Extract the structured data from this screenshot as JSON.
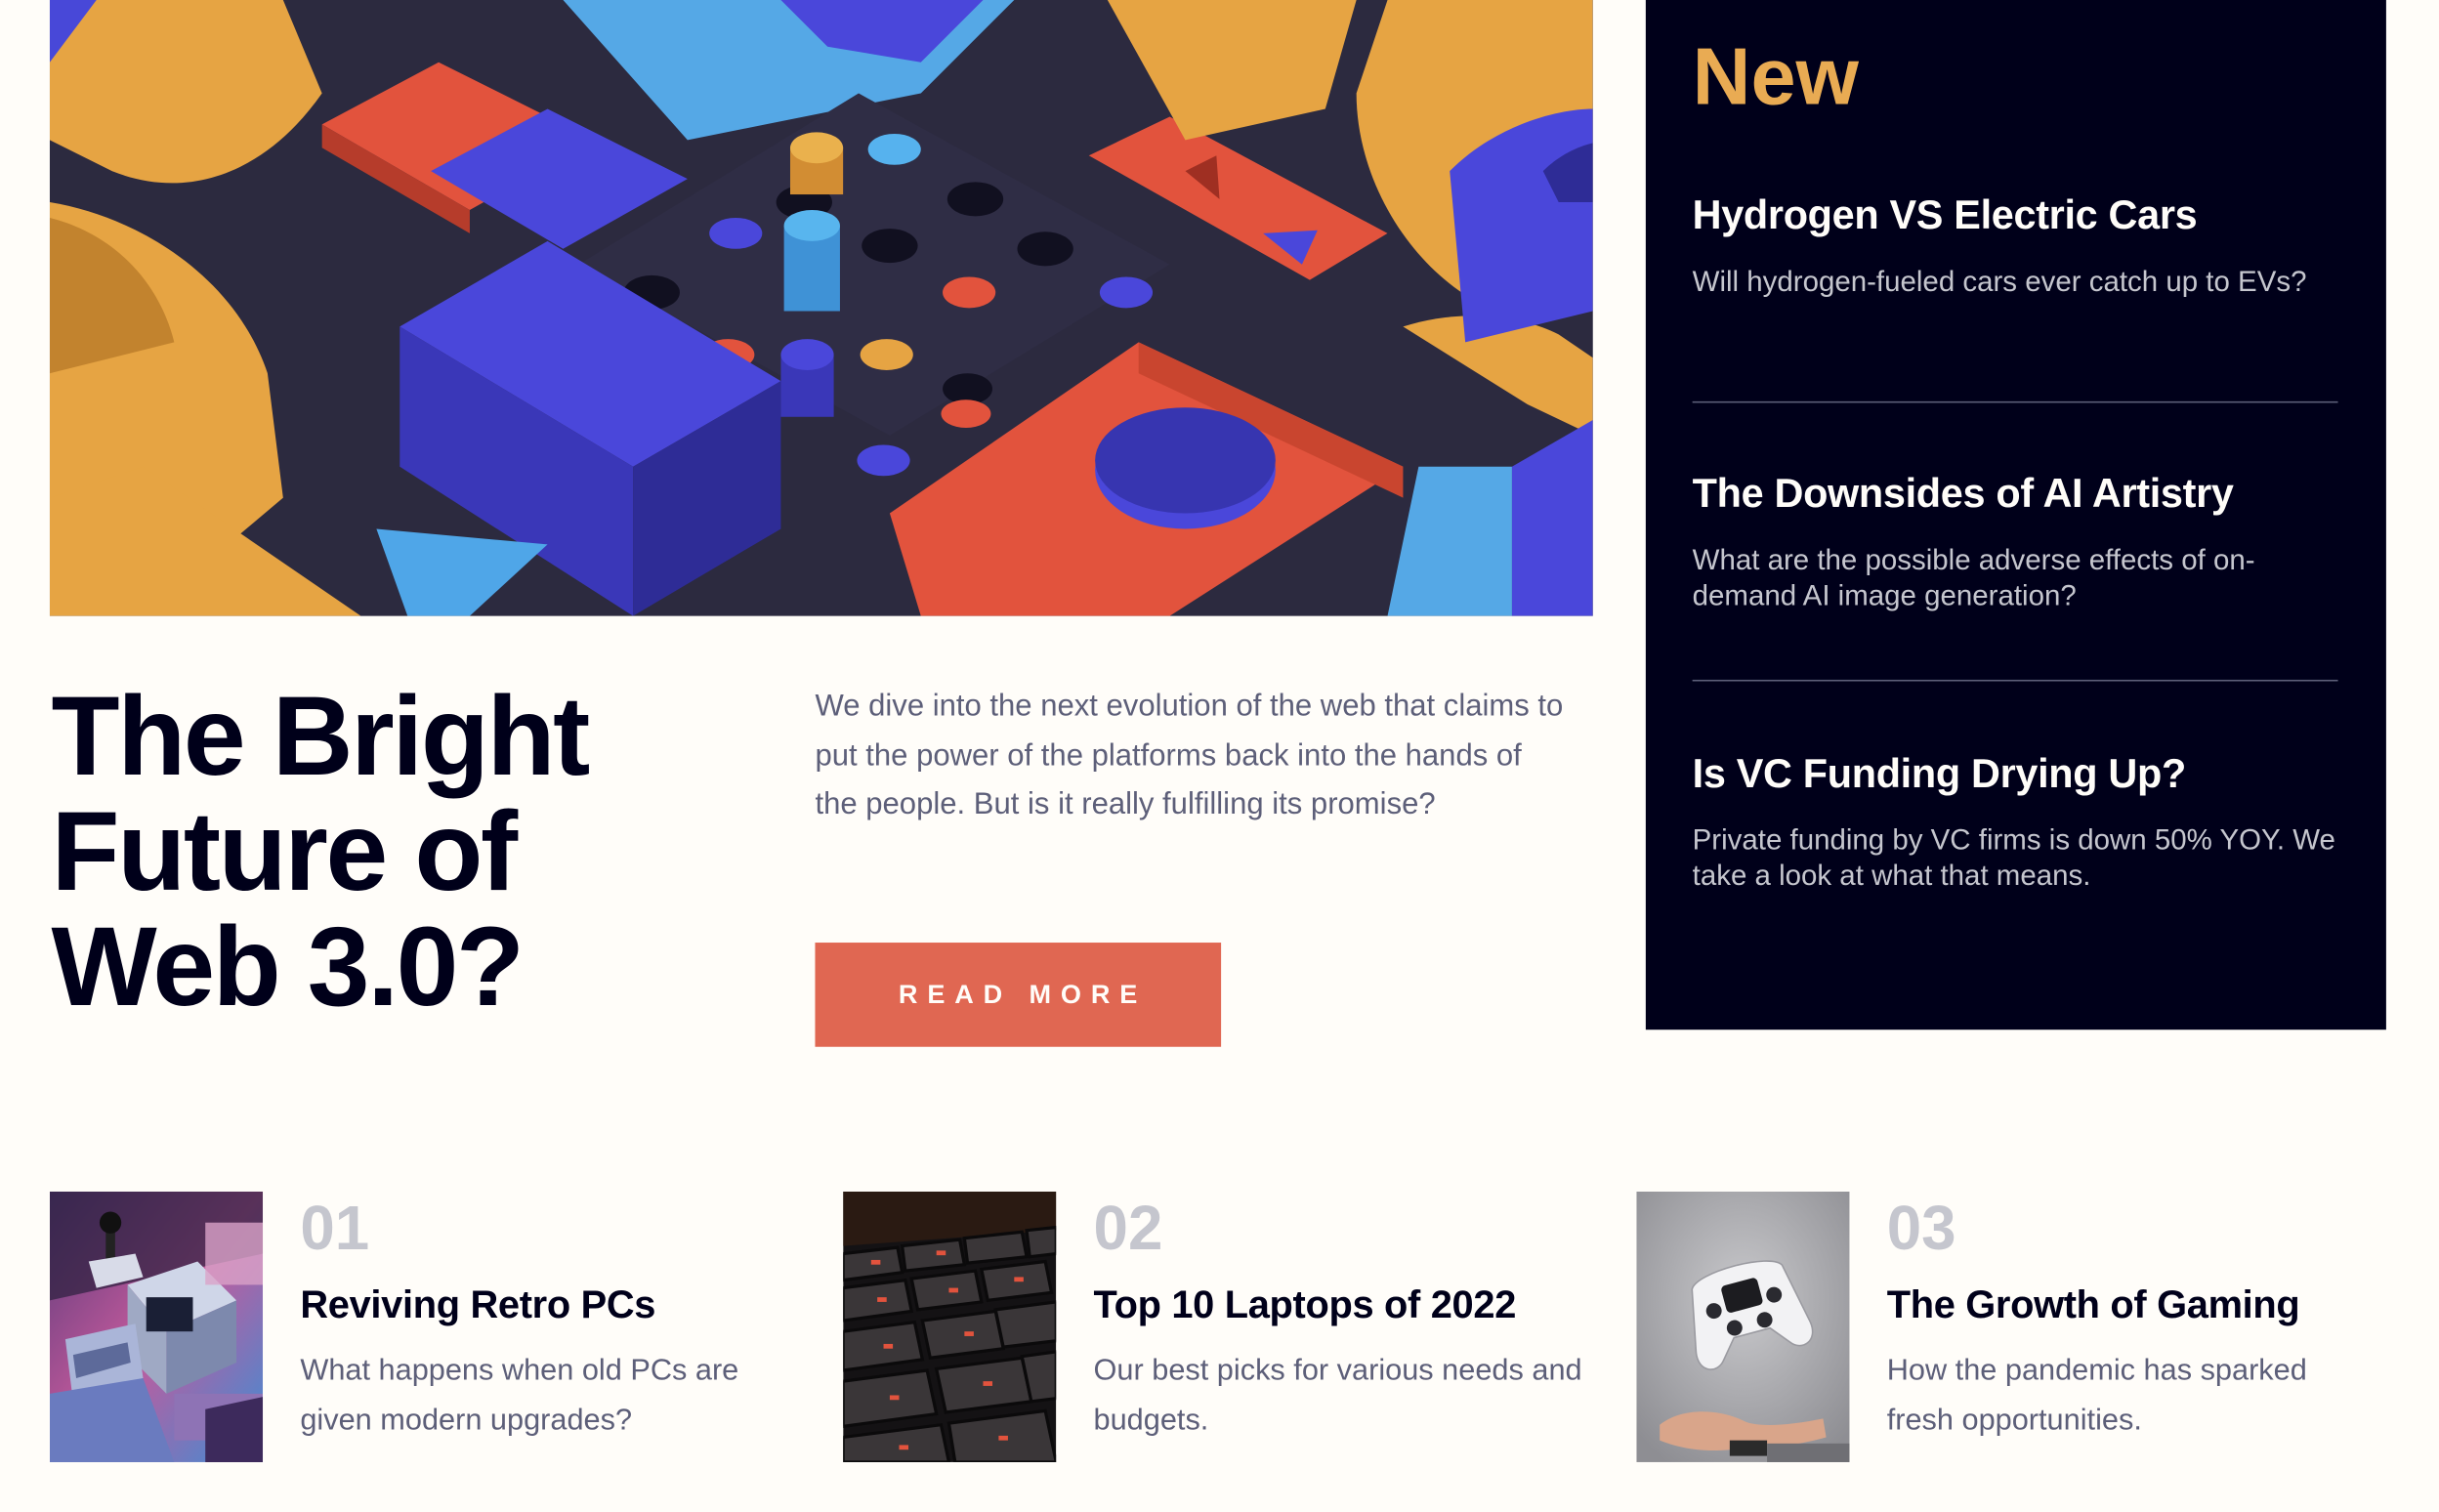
{
  "colors": {
    "background": "#fffdf9",
    "dark_navy": "#00001a",
    "accent_gold": "#e9ab53",
    "accent_red": "#e06752",
    "text_grayish_blue": "#5d5f79",
    "grayish_blue_light": "#c5c6ce"
  },
  "hero": {
    "image_alt": "hero-image",
    "title": "The Bright Future of Web 3.0?",
    "description": "We dive into the next evolution of the web that claims to put the power of the platforms back into the hands of the people. But is it really fulfilling its promise?",
    "button_label": "READ MORE"
  },
  "new_panel": {
    "heading": "New",
    "items": [
      {
        "title": "Hydrogen VS Electric Cars",
        "description": "Will hydrogen-fueled cars ever catch up to EVs?"
      },
      {
        "title": "The Downsides of AI Artistry",
        "description": "What are the possible adverse effects of on-demand AI image generation?"
      },
      {
        "title": "Is VC Funding Drying Up?",
        "description": "Private funding by VC firms is down 50% YOY. We take a look at what that means."
      }
    ]
  },
  "cards": [
    {
      "number": "01",
      "title": "Reviving Retro PCs",
      "description": "What happens when old PCs are given modern upgrades?",
      "thumb": "retro-pcs-image"
    },
    {
      "number": "02",
      "title": "Top 10 Laptops of 2022",
      "description": "Our best picks for various needs and budgets.",
      "thumb": "laptop-keyboard-image"
    },
    {
      "number": "03",
      "title": "The Growth of Gaming",
      "description": "How the pandemic has sparked fresh opportunities.",
      "thumb": "game-controller-image"
    }
  ]
}
